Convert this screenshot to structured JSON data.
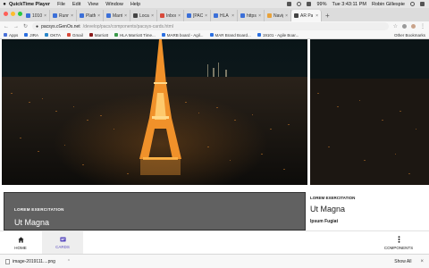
{
  "menubar": {
    "app_name": "QuickTime Player",
    "items": [
      "File",
      "Edit",
      "View",
      "Window",
      "Help"
    ],
    "battery": "99%",
    "clock": "Tue 3:43:11 PM",
    "user": "Robin Gillespie"
  },
  "tabs": [
    {
      "label": "1010",
      "color": "#3b6fd8"
    },
    {
      "label": "Runni",
      "color": "#3b6fd8"
    },
    {
      "label": "Platfo",
      "color": "#3b6fd8"
    },
    {
      "label": "Marrio",
      "color": "#3b6fd8"
    },
    {
      "label": "Locati",
      "color": "#444444"
    },
    {
      "label": "Inbox",
      "color": "#d84a3b"
    },
    {
      "label": "[PACS",
      "color": "#3b6fd8"
    },
    {
      "label": "HLA",
      "color": "#3b6fd8"
    },
    {
      "label": "https:",
      "color": "#3b6fd8"
    },
    {
      "label": "Naviga",
      "color": "#e8a23a"
    },
    {
      "label": "AR Pa",
      "color": "#444444"
    }
  ],
  "active_tab": "AR Pa",
  "address": {
    "domain": "pacsys.cGenOs.net",
    "path": "/develop/pacs/components/pacsys-cards.html"
  },
  "bookmarks": [
    {
      "label": "Apps",
      "color": "#4a72d8"
    },
    {
      "label": "JIRA",
      "color": "#2b6fe0"
    },
    {
      "label": "OKTA",
      "color": "#2a86c9"
    },
    {
      "label": "Gmail",
      "color": "#d84a3b"
    },
    {
      "label": "Marriott",
      "color": "#8a1a1a"
    },
    {
      "label": "HLA Marriott Time...",
      "color": "#3b9a4a"
    },
    {
      "label": "MARB board - Agil...",
      "color": "#2b6fe0"
    },
    {
      "label": "MAR Brand Board...",
      "color": "#2b6fe0"
    },
    {
      "label": "19101 - Agile Boar...",
      "color": "#2b6fe0"
    }
  ],
  "other_bookmarks": "Other Bookmarks",
  "card_main": {
    "eyebrow": "LOREM EXERCITATION",
    "title": "Ut Magna"
  },
  "card_side": {
    "eyebrow": "LOREM EXERCITATION",
    "title": "Ut Magna",
    "subtitle": "Ipsum Fugiat"
  },
  "bottom_nav": {
    "home": "HOME",
    "cards": "CARDS",
    "components": "COMPONENTS",
    "active": "CARDS"
  },
  "download": {
    "filename": "image-2019111....png",
    "show_all": "Show All"
  },
  "colors": {
    "accent": "#5b4cbf",
    "card_bg": "#616161",
    "night_sky": "#0b1416",
    "tower_light": "#ffb347"
  }
}
